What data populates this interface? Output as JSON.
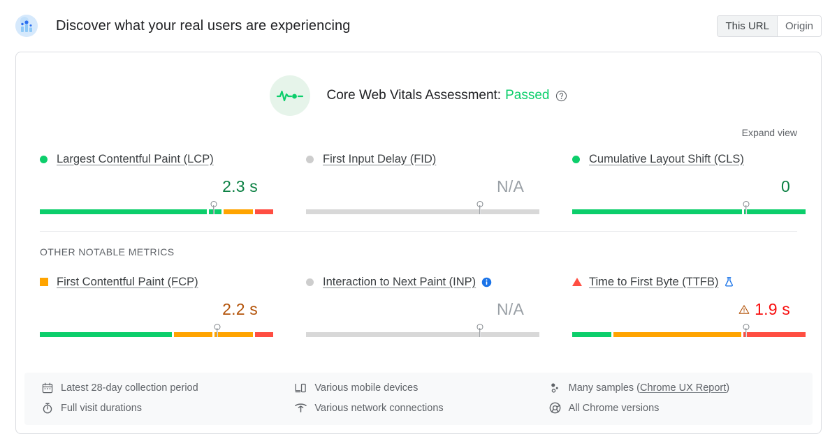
{
  "header": {
    "icon": "users-chart-icon",
    "title": "Discover what your real users are experiencing",
    "scope_toggle": {
      "options": [
        {
          "label": "This URL",
          "selected": true
        },
        {
          "label": "Origin",
          "selected": false
        }
      ]
    }
  },
  "assessment": {
    "icon": "pulse-icon",
    "label": "Core Web Vitals Assessment:",
    "status": "Passed",
    "help_icon": "help-circle-icon",
    "expand_label": "Expand view"
  },
  "sections": {
    "other_metrics_title": "OTHER NOTABLE METRICS"
  },
  "core_metrics": [
    {
      "name": "Largest Contentful Paint (LCP)",
      "marker": "dot-good",
      "value": "2.3 s",
      "value_state": "good",
      "pin_pct": 73.5,
      "segments": [
        {
          "color": "green",
          "pct": 73.5
        },
        {
          "color": "green",
          "pct": 5.5
        },
        {
          "color": "orange",
          "pct": 13
        },
        {
          "color": "red",
          "pct": 8
        }
      ]
    },
    {
      "name": "First Input Delay (FID)",
      "marker": "dot-na",
      "value": "N/A",
      "value_state": "na",
      "pin_pct": 73.5,
      "segments": [
        {
          "color": "grey",
          "pct": 73.5
        },
        {
          "color": "grey",
          "pct": 26.5
        }
      ]
    },
    {
      "name": "Cumulative Layout Shift (CLS)",
      "marker": "dot-good",
      "value": "0",
      "value_state": "good",
      "pin_pct": 73.5,
      "segments": [
        {
          "color": "green",
          "pct": 73.5
        },
        {
          "color": "green",
          "pct": 26.5
        }
      ]
    }
  ],
  "other_metrics": [
    {
      "name": "First Contentful Paint (FCP)",
      "marker": "square-avg",
      "value": "2.2 s",
      "value_state": "avg",
      "pin_pct": 75,
      "segments": [
        {
          "color": "green",
          "pct": 58
        },
        {
          "color": "orange",
          "pct": 17
        },
        {
          "color": "orange",
          "pct": 17
        },
        {
          "color": "red",
          "pct": 8
        }
      ]
    },
    {
      "name": "Interaction to Next Paint (INP)",
      "marker": "dot-na",
      "badge_icon": "info-circle-icon",
      "value": "N/A",
      "value_state": "na",
      "pin_pct": 73.5,
      "segments": [
        {
          "color": "grey",
          "pct": 73.5
        },
        {
          "color": "grey",
          "pct": 26.5
        }
      ]
    },
    {
      "name": "Time to First Byte (TTFB)",
      "marker": "triangle-poor",
      "badge_icon": "flask-icon",
      "warning_icon": "warning-triangle-icon",
      "value": "1.9 s",
      "value_state": "poor",
      "pin_pct": 73.5,
      "segments": [
        {
          "color": "green",
          "pct": 17
        },
        {
          "color": "orange",
          "pct": 56
        },
        {
          "color": "red",
          "pct": 27
        }
      ]
    }
  ],
  "footer": [
    {
      "icon": "calendar-icon",
      "text": "Latest 28-day collection period"
    },
    {
      "icon": "devices-icon",
      "text": "Various mobile devices"
    },
    {
      "icon": "samples-icon",
      "text": "Many samples (",
      "link": "Chrome UX Report",
      "text_after": ")"
    },
    {
      "icon": "stopwatch-icon",
      "text": "Full visit durations"
    },
    {
      "icon": "network-icon",
      "text": "Various network connections"
    },
    {
      "icon": "chrome-icon",
      "text": "All Chrome versions"
    }
  ],
  "colors": {
    "good": "#0cce6b",
    "average": "#ffa400",
    "poor": "#ff4e42",
    "na": "#d8d8d8",
    "link_blue": "#1a73e8"
  }
}
